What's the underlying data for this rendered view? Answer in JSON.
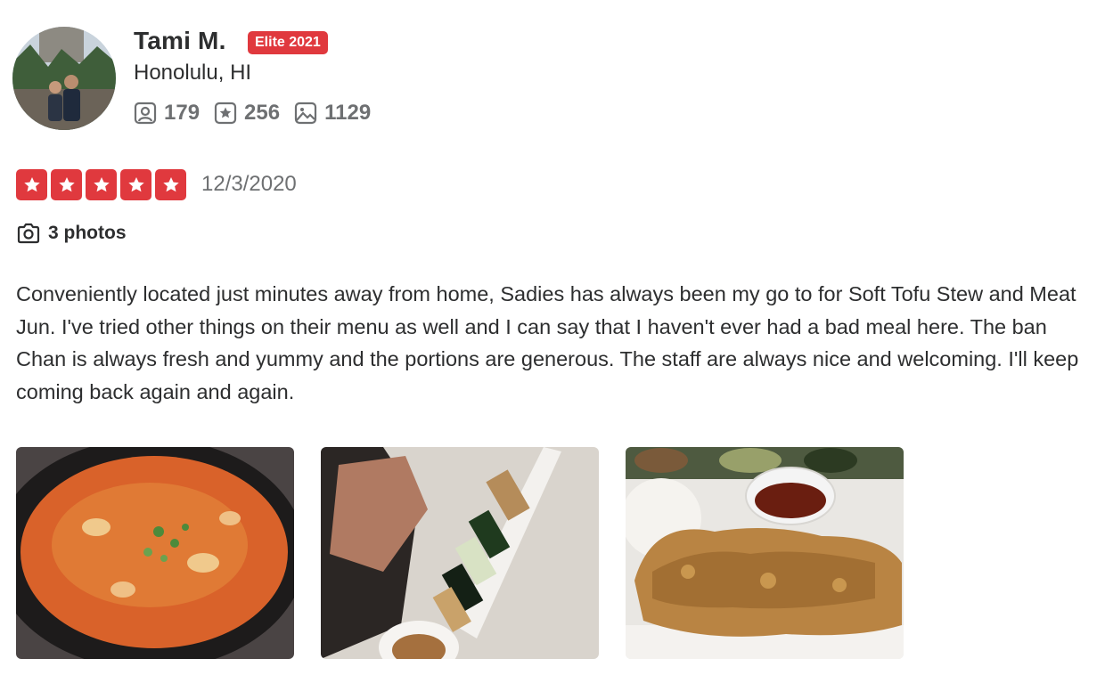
{
  "reviewer": {
    "name": "Tami M.",
    "elite_badge": "Elite 2021",
    "location": "Honolulu, HI",
    "stats": {
      "friends": "179",
      "reviews": "256",
      "photos": "1129"
    }
  },
  "review": {
    "rating": 5,
    "rating_max": 5,
    "date": "12/3/2020",
    "photos_label": "3 photos",
    "text": "Conveniently located just minutes away from home, Sadies has always been my go to for Soft Tofu Stew and Meat Jun. I've tried other things on their menu as well and I can say that I haven't ever had a bad meal here. The ban Chan is always fresh and yummy and the portions are generous. The staff are always nice and welcoming. I'll keep coming back again and again."
  },
  "colors": {
    "brand_red": "#e0393e",
    "text_dark": "#2d2e2f",
    "text_muted": "#6e7072"
  },
  "icons": {
    "friends": "friends-icon",
    "reviews": "star-icon",
    "photos": "photo-icon",
    "camera": "camera-icon"
  }
}
